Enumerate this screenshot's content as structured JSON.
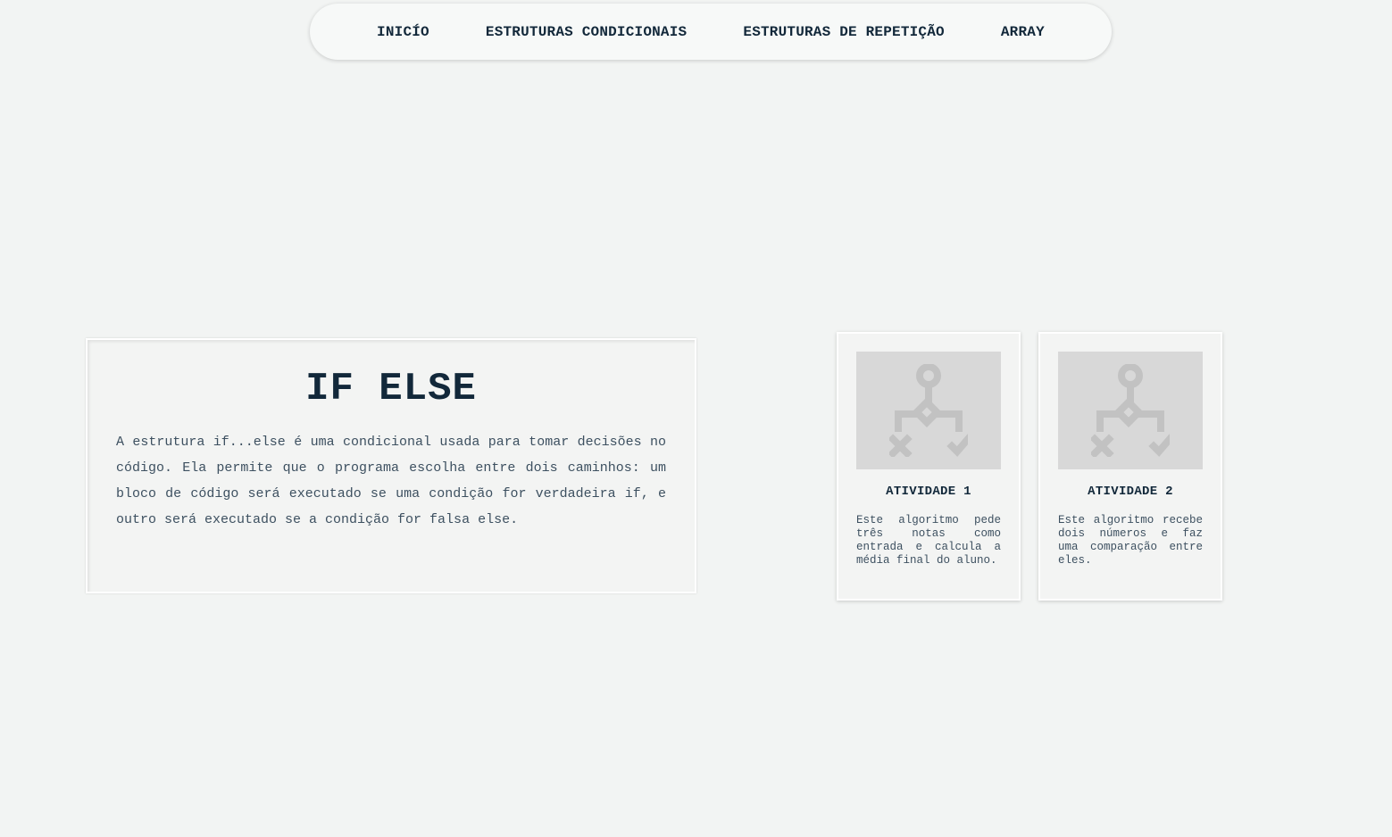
{
  "nav": {
    "items": [
      {
        "label": "INICÍO"
      },
      {
        "label": "ESTRUTURAS CONDICIONAIS"
      },
      {
        "label": "ESTRUTURAS DE REPETIÇÃO"
      },
      {
        "label": "ARRAY"
      }
    ]
  },
  "info": {
    "title": "IF ELSE",
    "text": "A estrutura if...else é uma condicional usada para tomar decisões no código. Ela permite que o programa escolha entre dois caminhos: um bloco de código será executado se uma condição for verdadeira if, e outro será executado se a condição for falsa else."
  },
  "cards": [
    {
      "title": "ATIVIDADE 1",
      "text": "Este algoritmo pede três notas como entrada e calcula a média final do aluno.",
      "icon": "decision-flow-icon"
    },
    {
      "title": "ATIVIDADE 2",
      "text": "Este algoritmo recebe dois números e faz uma comparação entre eles.",
      "icon": "decision-flow-icon"
    }
  ],
  "colors": {
    "background": "#f2f4f3",
    "text_dark": "#12283a",
    "text_body": "#3d5060",
    "image_placeholder": "#d8d8d8",
    "icon": "#c2c2c2"
  }
}
